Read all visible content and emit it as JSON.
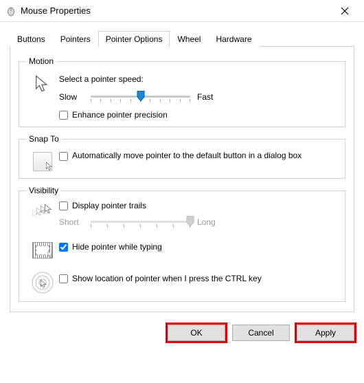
{
  "window": {
    "title": "Mouse Properties"
  },
  "tabs": [
    "Buttons",
    "Pointers",
    "Pointer Options",
    "Wheel",
    "Hardware"
  ],
  "motion": {
    "legend": "Motion",
    "select_label": "Select a pointer speed:",
    "slow": "Slow",
    "fast": "Fast",
    "enhance": "Enhance pointer precision"
  },
  "snapto": {
    "legend": "Snap To",
    "auto": "Automatically move pointer to the default button in a dialog box"
  },
  "visibility": {
    "legend": "Visibility",
    "trails": "Display pointer trails",
    "short": "Short",
    "long": "Long",
    "hide": "Hide pointer while typing",
    "ctrl": "Show location of pointer when I press the CTRL key"
  },
  "buttons": {
    "ok": "OK",
    "cancel": "Cancel",
    "apply": "Apply"
  }
}
